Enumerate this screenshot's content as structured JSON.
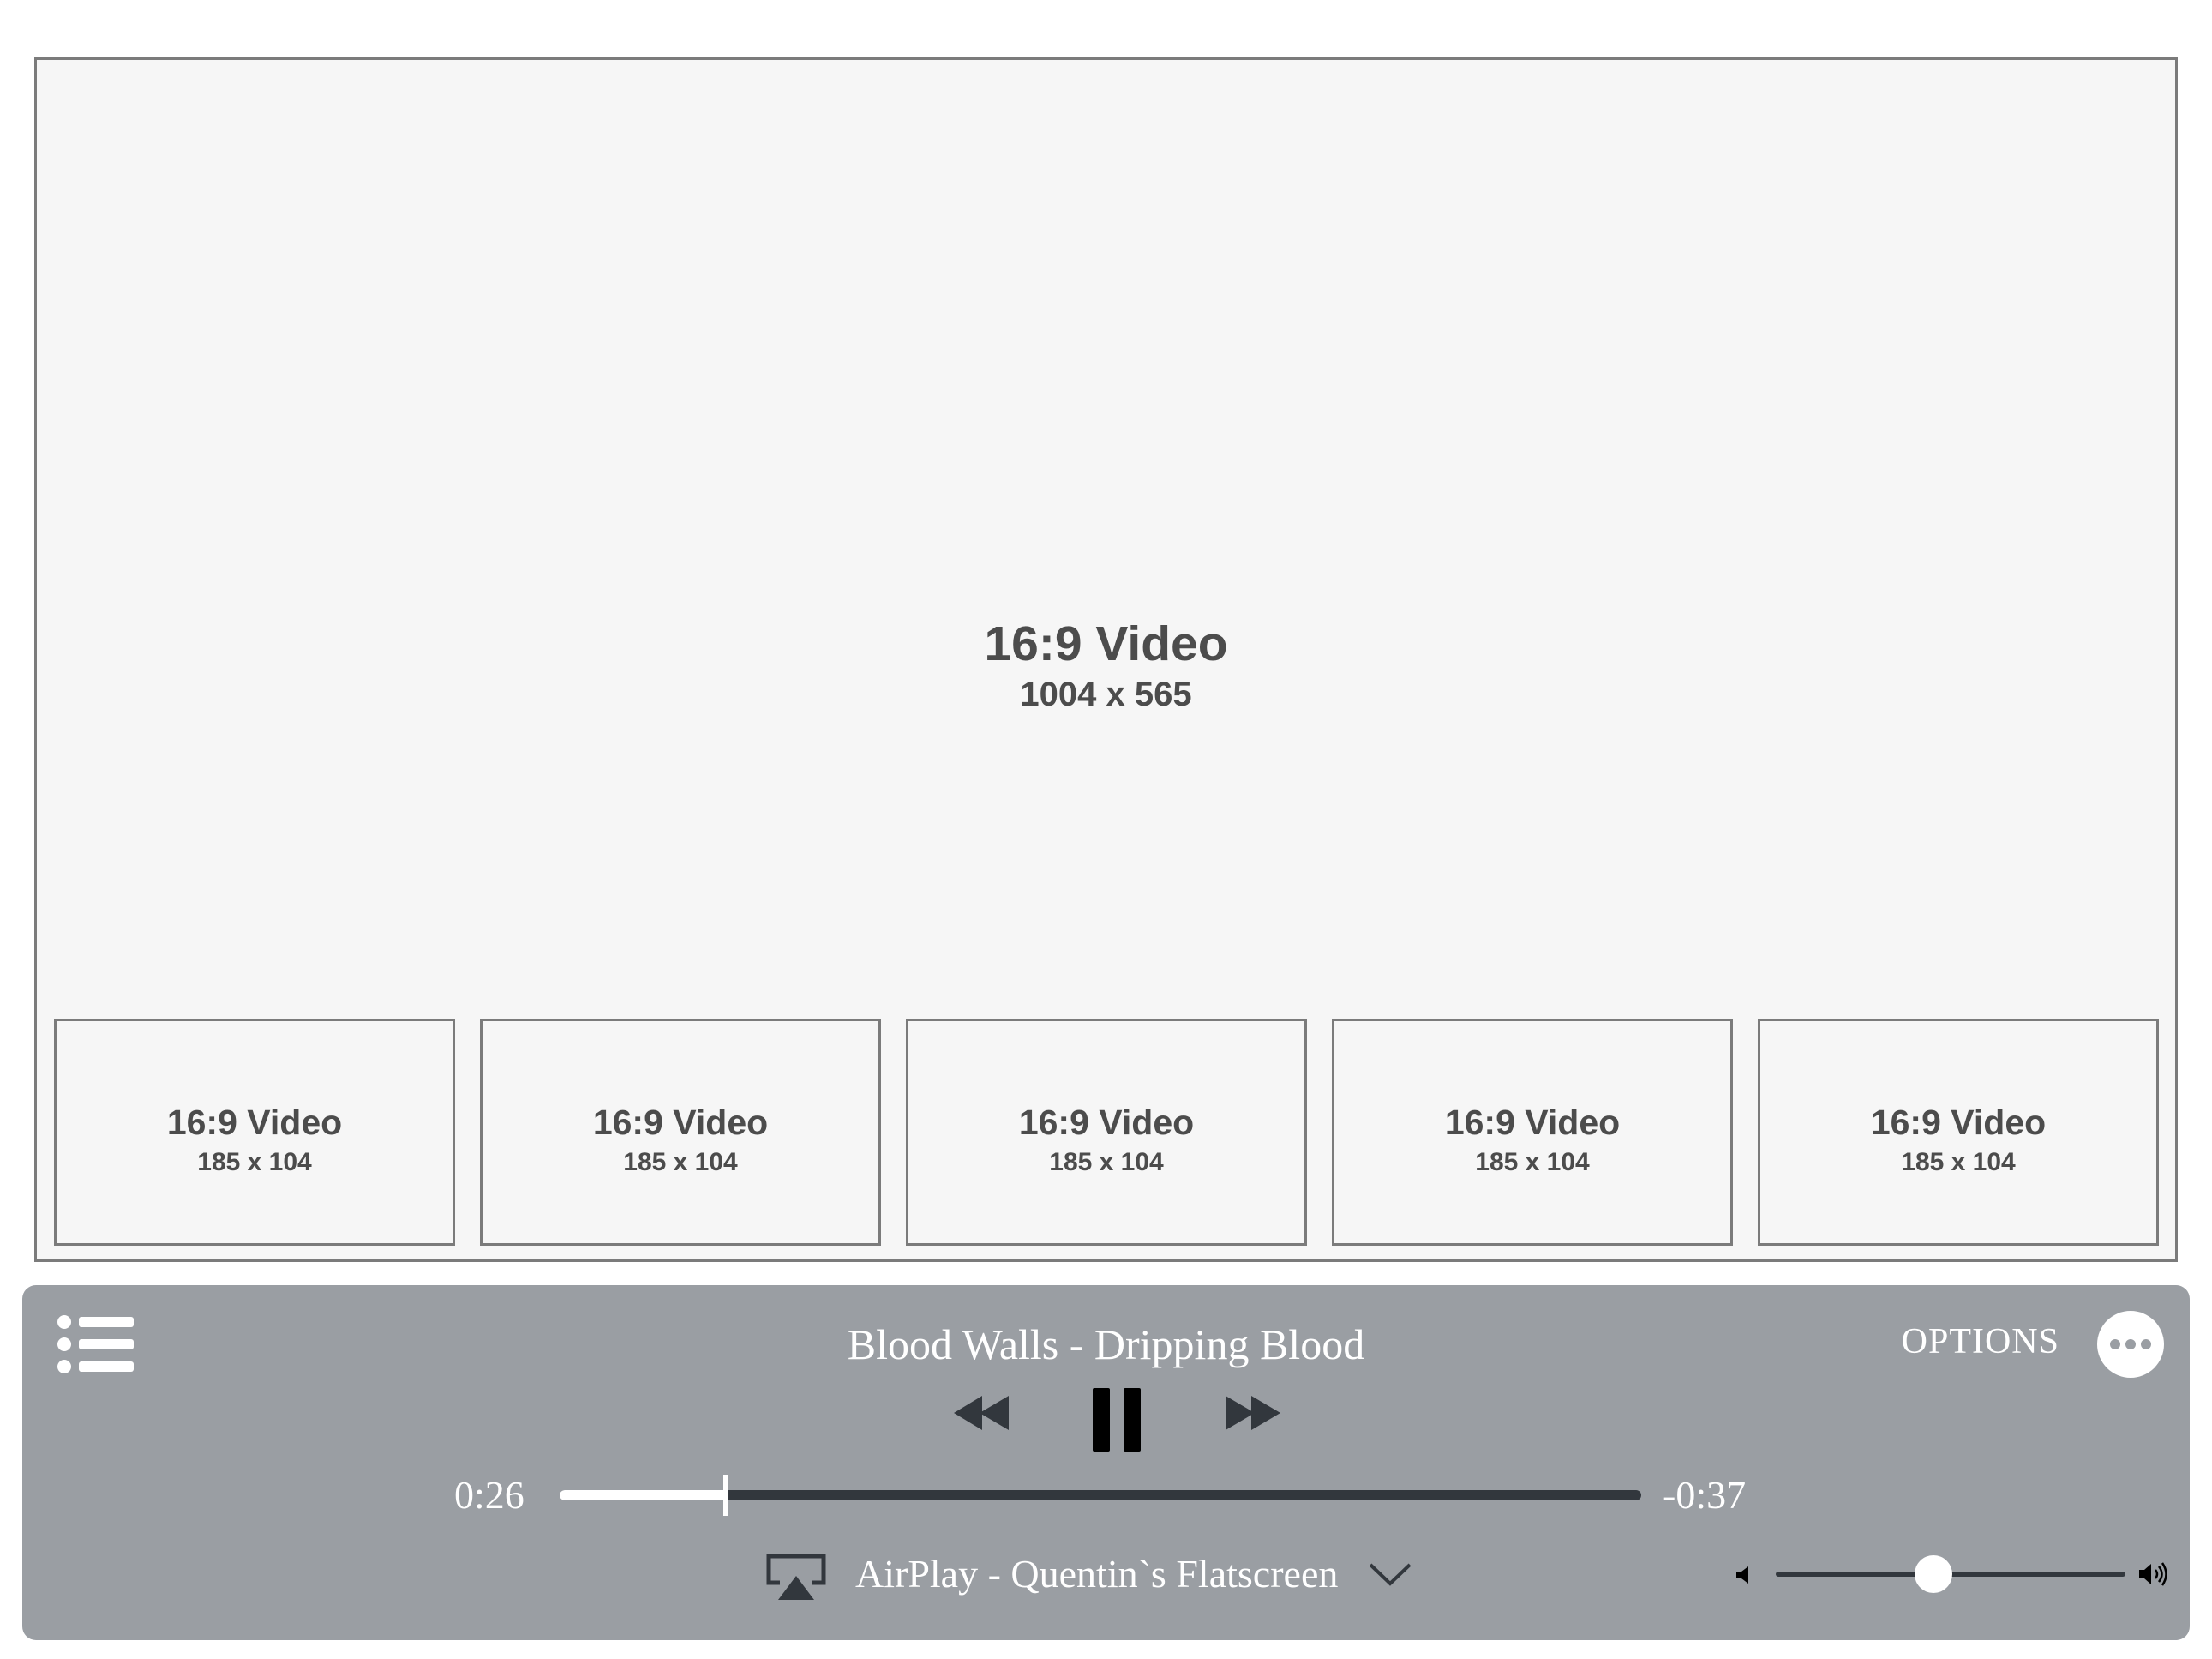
{
  "main_video": {
    "title": "16:9 Video",
    "size": "1004 x 565"
  },
  "thumbnails": [
    {
      "title": "16:9 Video",
      "size": "185 x 104"
    },
    {
      "title": "16:9 Video",
      "size": "185 x 104"
    },
    {
      "title": "16:9 Video",
      "size": "185 x 104"
    },
    {
      "title": "16:9 Video",
      "size": "185 x 104"
    },
    {
      "title": "16:9 Video",
      "size": "185 x 104"
    }
  ],
  "player": {
    "track_title": "Blood Walls - Dripping Blood",
    "options_label": "OPTIONS",
    "time_elapsed": "0:26",
    "time_remaining": "-0:37",
    "progress_fraction": 0.154,
    "airplay_label": "AirPlay - Quentin`s Flatscreen",
    "volume_fraction": 0.45,
    "icons": {
      "playlist": "list-icon",
      "more": "ellipsis-icon",
      "rewind": "rewind-icon",
      "pause": "pause-icon",
      "forward": "fast-forward-icon",
      "airplay": "airplay-icon",
      "dropdown": "chevron-down-icon",
      "volume_low": "speaker-low-icon",
      "volume_high": "speaker-high-icon"
    },
    "colors": {
      "bar_background": "#9a9ea3",
      "track_dark": "#32373d",
      "foreground": "#ffffff"
    }
  }
}
